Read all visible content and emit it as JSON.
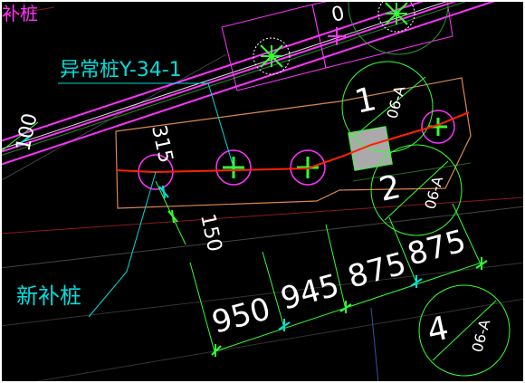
{
  "drawing": {
    "colors": {
      "background": "#000000",
      "axis_magenta": "#ff33ff",
      "cyan_leader": "#00dddd",
      "green_dim": "#33ff33",
      "pile_cross": "#33ff33",
      "gray_cap": "#aaaaaa",
      "orange_outline": "#d88850",
      "red_path": "#ff2200",
      "white_text": "#ffffff"
    },
    "labels": {
      "top_left_fragment": "补桩",
      "abnormal_pile": "异常桩Y-34-1",
      "new_pile": "新补桩",
      "top_zero": "0",
      "dim_100": "100",
      "dim_315": "315",
      "dim_150": "150"
    },
    "dimensions": [
      "950",
      "945",
      "875",
      "875"
    ],
    "bubbles": [
      {
        "number": "1",
        "tag": "06-A"
      },
      {
        "number": "2",
        "tag": "06-A"
      },
      {
        "number": "4",
        "tag": "06-A"
      }
    ]
  }
}
